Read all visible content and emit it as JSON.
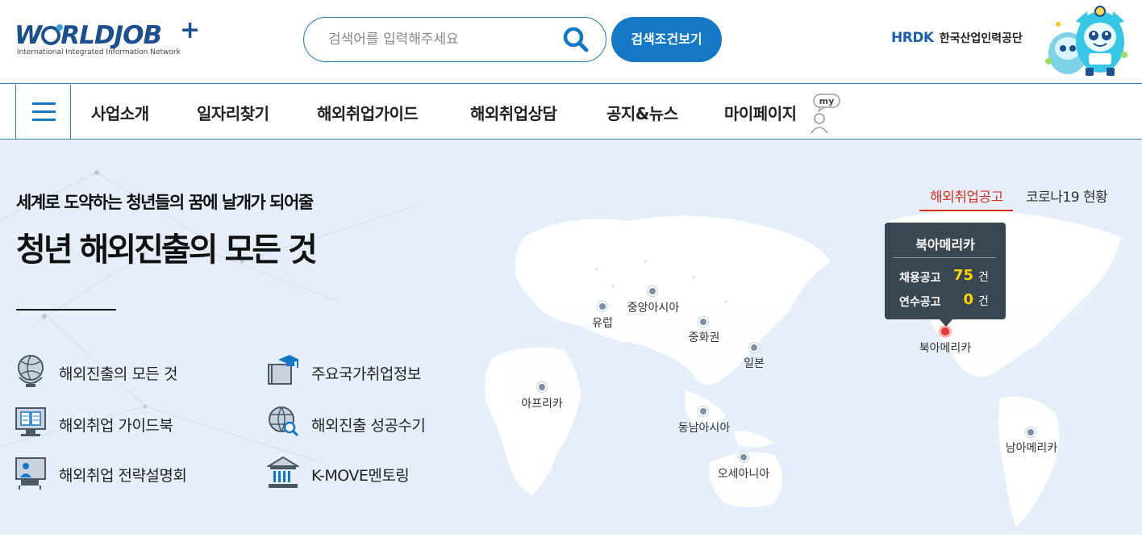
{
  "header": {
    "logo_text": "WORLDJOB",
    "logo_plus": "+",
    "logo_subtitle": "International Integrated Information Network",
    "search_placeholder": "검색어를 입력해주세요",
    "search_condition_button": "검색조건보기",
    "partner_logo": "HRDK",
    "partner_name": "한국산업인력공단"
  },
  "nav": {
    "items": [
      {
        "label": "사업소개"
      },
      {
        "label": "일자리찾기"
      },
      {
        "label": "해외취업가이드"
      },
      {
        "label": "해외취업상담"
      },
      {
        "label": "공지&뉴스"
      },
      {
        "label": "마이페이지"
      }
    ],
    "my_badge": "my"
  },
  "hero": {
    "tagline": "세계로 도약하는 청년들의 꿈에 날개가 되어줄",
    "headline": "청년 해외진출의 모든 것",
    "quick_links": [
      {
        "label": "해외진출의 모든 것",
        "icon": "globe-icon"
      },
      {
        "label": "주요국가취업정보",
        "icon": "graduation-book-icon"
      },
      {
        "label": "해외취업 가이드북",
        "icon": "guidebook-icon"
      },
      {
        "label": "해외진출 성공수기",
        "icon": "globe-search-icon"
      },
      {
        "label": "해외취업 전략설명회",
        "icon": "presentation-icon"
      },
      {
        "label": "K-MOVE멘토링",
        "icon": "institution-icon"
      }
    ]
  },
  "map": {
    "tabs": [
      {
        "label": "해외취업공고",
        "active": true
      },
      {
        "label": "코로나19 현황",
        "active": false
      }
    ],
    "regions": [
      {
        "name": "유럽"
      },
      {
        "name": "중앙아시아"
      },
      {
        "name": "중화권"
      },
      {
        "name": "일본"
      },
      {
        "name": "아프리카"
      },
      {
        "name": "동남아시아"
      },
      {
        "name": "오세아니아"
      },
      {
        "name": "북아메리카",
        "active": true
      },
      {
        "name": "남아메리카"
      }
    ],
    "tooltip": {
      "title": "북아메리카",
      "job_label": "채용공고",
      "job_count": "75",
      "training_label": "연수공고",
      "training_count": "0",
      "unit": "건"
    }
  },
  "colors": {
    "brand_blue": "#1478c6",
    "active_red": "#d93025",
    "hero_bg": "#e6eff9",
    "tooltip_bg": "#3b4653",
    "count_yellow": "#ffd400"
  }
}
